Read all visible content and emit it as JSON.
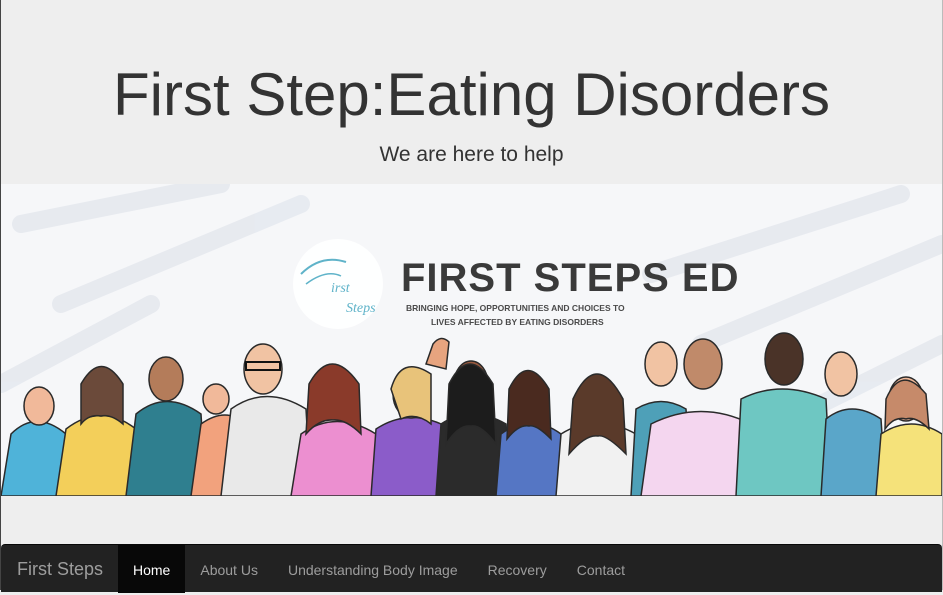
{
  "header": {
    "title": "First Step:Eating Disorders",
    "subtitle": "We are here to help"
  },
  "banner": {
    "logo_text": "First Steps",
    "heading": "FIRST STEPS ED",
    "tagline_line1": "BRINGING HOPE, OPPORTUNITIES AND CHOICES TO",
    "tagline_line2": "LIVES AFFECTED BY EATING DISORDERS",
    "accent_color": "#5fb3c9"
  },
  "navbar": {
    "brand": "First Steps",
    "items": [
      {
        "label": "Home",
        "active": true
      },
      {
        "label": "About Us"
      },
      {
        "label": "Understanding Body Image"
      },
      {
        "label": "Recovery"
      },
      {
        "label": "Contact"
      }
    ],
    "background": "#222222",
    "active_background": "#080808"
  }
}
